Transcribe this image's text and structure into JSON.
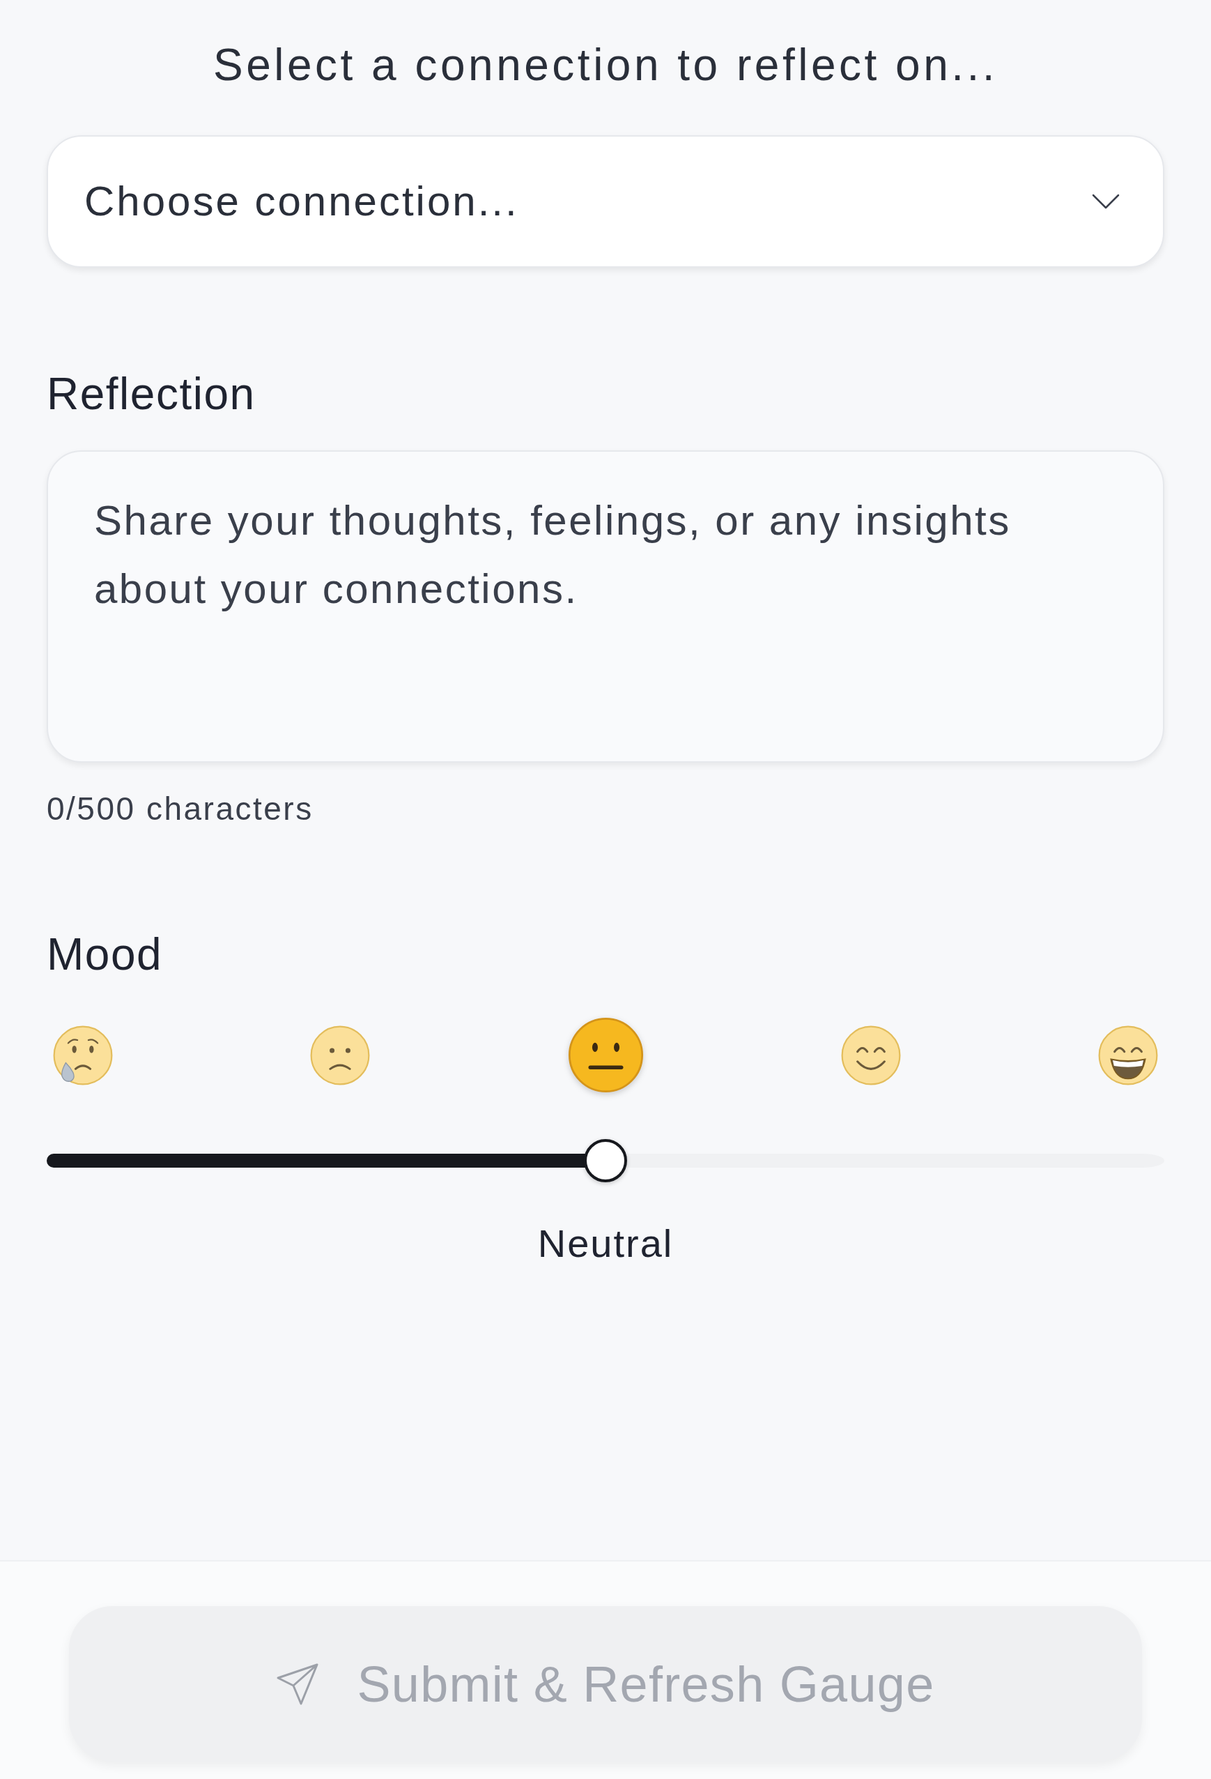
{
  "heading": "Select a connection to reflect on...",
  "connection_select": {
    "placeholder": "Choose connection..."
  },
  "reflection": {
    "label": "Reflection",
    "placeholder": "Share your thoughts, feelings, or any insights about your connections.",
    "counter": "0/500 characters"
  },
  "mood": {
    "label": "Mood",
    "options": [
      {
        "selected": false
      },
      {
        "selected": false
      },
      {
        "selected": true
      },
      {
        "selected": false
      },
      {
        "selected": false
      }
    ],
    "slider": {
      "level": 0.5
    },
    "reading": "Neutral"
  },
  "submit_button": {
    "label": "Submit & Refresh Gauge",
    "disabled": true
  }
}
